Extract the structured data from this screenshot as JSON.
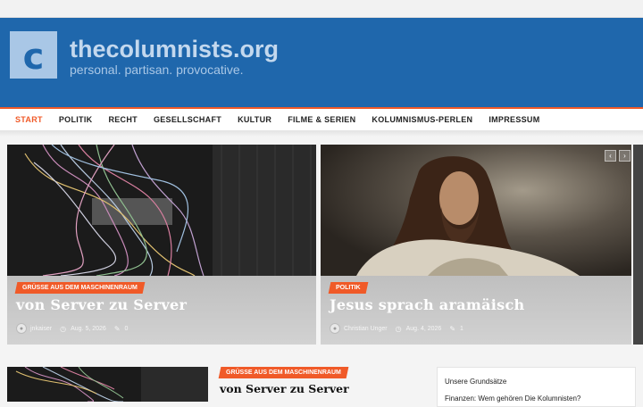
{
  "site": {
    "logo_letter": "c",
    "title": "thecolumnists.org",
    "tagline": "personal. partisan. provocative."
  },
  "nav": {
    "items": [
      {
        "label": "START",
        "active": true
      },
      {
        "label": "POLITIK",
        "active": false
      },
      {
        "label": "RECHT",
        "active": false
      },
      {
        "label": "GESELLSCHAFT",
        "active": false
      },
      {
        "label": "KULTUR",
        "active": false
      },
      {
        "label": "FILME & SERIEN",
        "active": false
      },
      {
        "label": "KOLUMNISMUS-PERLEN",
        "active": false
      },
      {
        "label": "IMPRESSUM",
        "active": false
      }
    ]
  },
  "slider": {
    "prev_icon": "‹",
    "next_icon": "›",
    "slides": [
      {
        "category": "GRÜSSE AUS DEM MASCHINENRAUM",
        "title": "von Server zu Server",
        "author": "jnkaiser",
        "date": "Aug. 5, 2026",
        "comments": "0",
        "image": "server-rack-cables"
      },
      {
        "category": "POLITIK",
        "title": "Jesus sprach aramäisch",
        "author": "Christian Unger",
        "date": "Aug. 4, 2026",
        "comments": "1",
        "image": "jesus-portrait"
      }
    ]
  },
  "latest_post": {
    "category": "GRÜSSE AUS DEM MASCHINENRAUM",
    "title": "von Server zu Server"
  },
  "sidebar_widget": {
    "items": [
      "Unsere Grundsätze",
      "Finanzen: Wem gehören Die Kolumnisten?"
    ]
  },
  "colors": {
    "header_blue": "#1f67ac",
    "accent_orange": "#f05a28"
  }
}
